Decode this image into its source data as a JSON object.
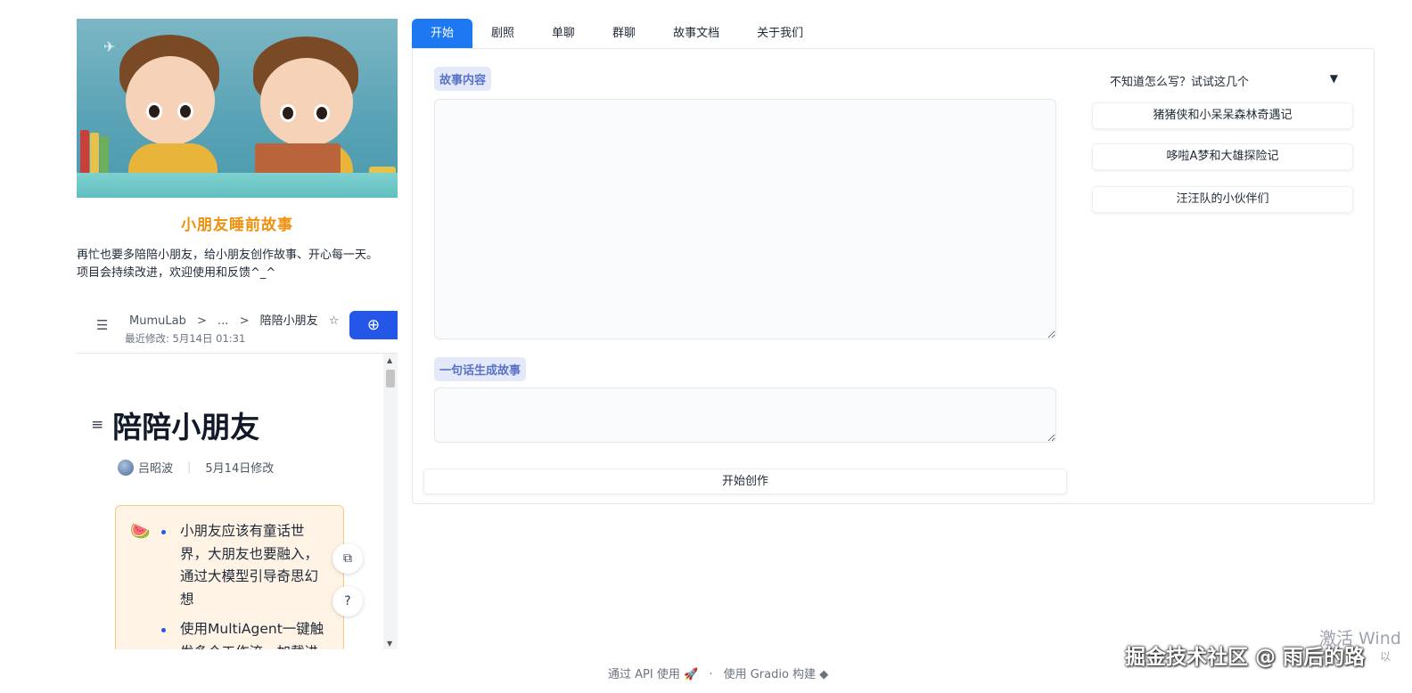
{
  "app": {
    "title": "小朋友睡前故事",
    "description_line1": "再忙也要多陪陪小朋友，给小朋友创作故事、开心每一天。",
    "description_line2": "项目会持续改进，欢迎使用和反馈^_^"
  },
  "doc_header": {
    "crumbs": [
      "MumuLab",
      "...",
      "陪陪小朋友"
    ],
    "separator": ">",
    "modified": "最近修改: 5月14日 01:31"
  },
  "doc": {
    "title": "陪陪小朋友",
    "author": "吕昭波",
    "date": "5月14日修改",
    "bullets": [
      "小朋友应该有童话世界，大朋友也要融入，通过大模型引导奇思幻想",
      "使用MultiAgent一键触发多个工作流，加载进"
    ]
  },
  "tabs": [
    {
      "label": "开始",
      "active": true
    },
    {
      "label": "剧照",
      "active": false
    },
    {
      "label": "单聊",
      "active": false
    },
    {
      "label": "群聊",
      "active": false
    },
    {
      "label": "故事文档",
      "active": false
    },
    {
      "label": "关于我们",
      "active": false
    }
  ],
  "form": {
    "story_label": "故事内容",
    "story_value": "",
    "sentence_label": "一句话生成故事",
    "sentence_value": "",
    "submit_label": "开始创作"
  },
  "examples": {
    "header": "不知道怎么写？试试这几个",
    "toggle": "▼",
    "items": [
      "猪猪侠和小呆呆森林奇遇记",
      "哆啦A梦和大雄探险记",
      "汪汪队的小伙伴们"
    ]
  },
  "footer": {
    "api": "通过 API 使用",
    "built": "使用 Gradio 构建",
    "dot": "·"
  },
  "overlay": {
    "activate": "激活 Wind",
    "activate_sub": "以",
    "watermark": "掘金技术社区 @ 雨后的路"
  },
  "colors": {
    "accent": "#1d78f2",
    "title_orange": "#f0900c",
    "label_bg": "#e3e9f8",
    "label_text": "#5872c8",
    "callout_bg": "#fef3e4"
  }
}
